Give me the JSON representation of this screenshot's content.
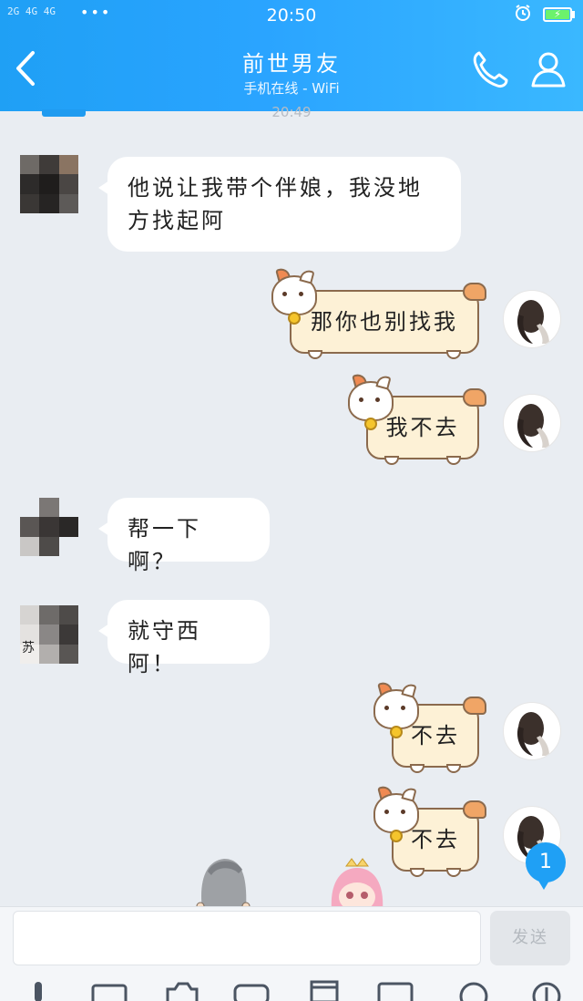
{
  "status_bar": {
    "signal_text": "2G 4G 4G",
    "time": "20:50"
  },
  "header": {
    "title": "前世男友",
    "subtitle": "手机在线 - WiFi",
    "timestamp": "20:49"
  },
  "messages": [
    {
      "side": "left",
      "type": "text",
      "lines": [
        "他说让我带个伴娘，我没地",
        "方找起阿"
      ]
    },
    {
      "side": "right",
      "type": "sticker-bubble",
      "text": "那你也别找我"
    },
    {
      "side": "right",
      "type": "sticker-bubble",
      "text": "我不去"
    },
    {
      "side": "left",
      "type": "text",
      "lines": [
        "帮一下啊？"
      ]
    },
    {
      "side": "left",
      "type": "text",
      "lines": [
        "就守西阿！"
      ],
      "avatar_char": "苏"
    },
    {
      "side": "right",
      "type": "sticker-bubble",
      "text": "不去"
    },
    {
      "side": "right",
      "type": "sticker-bubble",
      "text": "不去"
    }
  ],
  "unread_badge": "1",
  "input": {
    "placeholder": "",
    "send_label": "发送"
  },
  "colors": {
    "header_blue": "#1fa0f5",
    "chat_bg": "#e9edf2",
    "sticker_bubble": "#fdf1d6"
  },
  "toolbar_icons": [
    "mic-icon",
    "image-icon",
    "camera-icon",
    "wallet-icon",
    "gift-icon",
    "gif-icon",
    "emoji-icon",
    "plus-icon"
  ]
}
